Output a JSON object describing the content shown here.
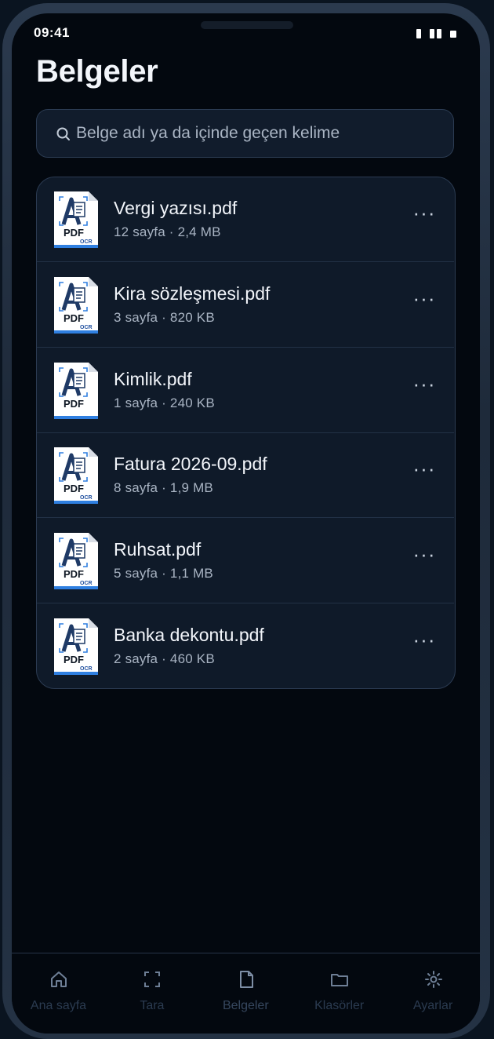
{
  "status_bar": {
    "time": "09:41"
  },
  "header": {
    "title": "Belgeler"
  },
  "search": {
    "placeholder": "Belge adı ya da içinde geçen kelime"
  },
  "documents": [
    {
      "name": "Vergi yazısı.pdf",
      "meta": "12 sayfa · 2,4 MB",
      "thumb_label": "PDF",
      "ocr_label": "OCR"
    },
    {
      "name": "Kira sözleşmesi.pdf",
      "meta": "3 sayfa · 820 KB",
      "thumb_label": "PDF",
      "ocr_label": "OCR"
    },
    {
      "name": "Kimlik.pdf",
      "meta": "1 sayfa · 240 KB",
      "thumb_label": "PDF",
      "ocr_label": ""
    },
    {
      "name": "Fatura 2026-09.pdf",
      "meta": "8 sayfa · 1,9 MB",
      "thumb_label": "PDF",
      "ocr_label": "OCR"
    },
    {
      "name": "Ruhsat.pdf",
      "meta": "5 sayfa · 1,1 MB",
      "thumb_label": "PDF",
      "ocr_label": "OCR"
    },
    {
      "name": "Banka dekontu.pdf",
      "meta": "2 sayfa · 460 KB",
      "thumb_label": "PDF",
      "ocr_label": "OCR"
    }
  ],
  "more_label": "···",
  "tabbar": {
    "tabs": [
      {
        "label": "Ana sayfa",
        "icon": "home-icon"
      },
      {
        "label": "Tara",
        "icon": "scan-icon"
      },
      {
        "label": "Belgeler",
        "icon": "document-icon",
        "active": true
      },
      {
        "label": "Klasörler",
        "icon": "folder-icon"
      },
      {
        "label": "Ayarlar",
        "icon": "settings-icon"
      }
    ]
  },
  "colors": {
    "background": "#03080f",
    "card": "#0f1a29",
    "border": "#2b3b52",
    "accent_blue": "#2f7fe0",
    "icon_navy": "#1f3a66"
  }
}
